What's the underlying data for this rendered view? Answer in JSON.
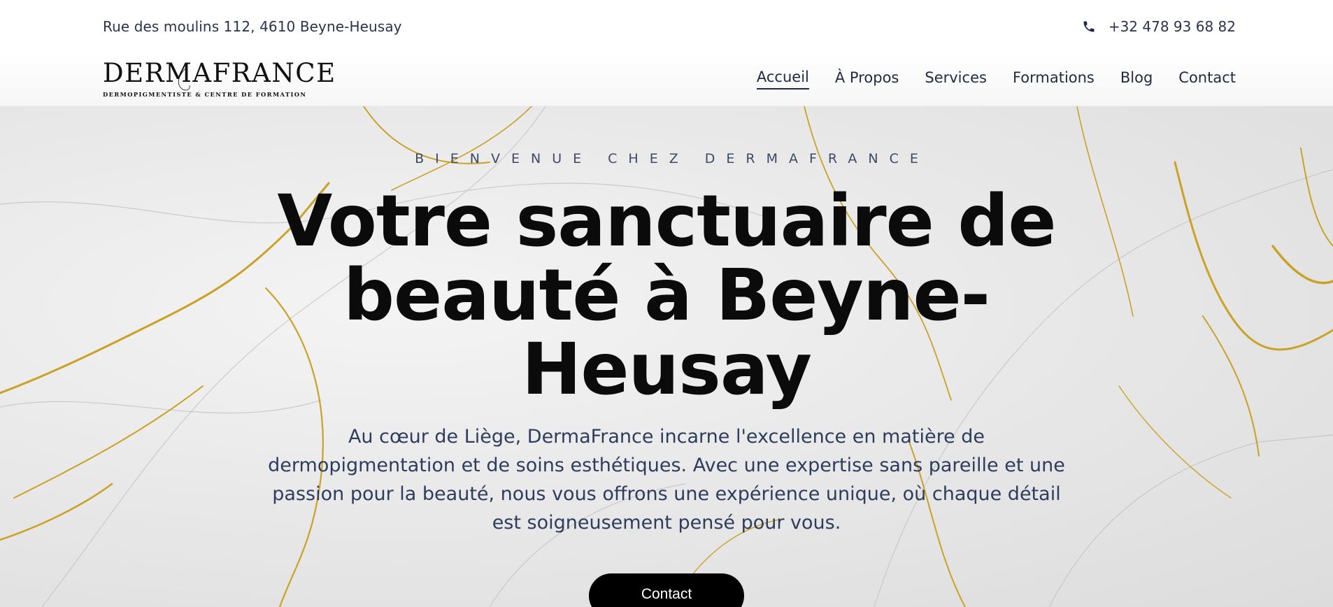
{
  "topbar": {
    "address": "Rue des moulins 112, 4610 Beyne-Heusay",
    "phone_icon": "phone-icon",
    "phone": "+32 478 93 68 82"
  },
  "logo": {
    "main": "DERMAFRANCE",
    "sub": "DERMOPIGMENTISTE & CENTRE DE FORMATION"
  },
  "nav": {
    "items": [
      {
        "label": "Accueil",
        "active": true
      },
      {
        "label": "À Propos"
      },
      {
        "label": "Services"
      },
      {
        "label": "Formations"
      },
      {
        "label": "Blog"
      },
      {
        "label": "Contact"
      }
    ]
  },
  "hero": {
    "eyebrow": "BIENVENUE CHEZ DERMAFRANCE",
    "title": "Votre sanctuaire de beauté à Beyne-Heusay",
    "lead": "Au cœur de Liège, DermaFrance incarne l'excellence en matière de dermopigmentation et de soins esthétiques. Avec une expertise sans pareille et une passion pour la beauté, nous vous offrons une expérience unique, où chaque détail est soigneusement pensé pour vous.",
    "cta_label": "Contact"
  },
  "colors": {
    "text_navy": "#1f2a44",
    "gold_vein": "#c9a227",
    "button_bg": "#000000"
  }
}
